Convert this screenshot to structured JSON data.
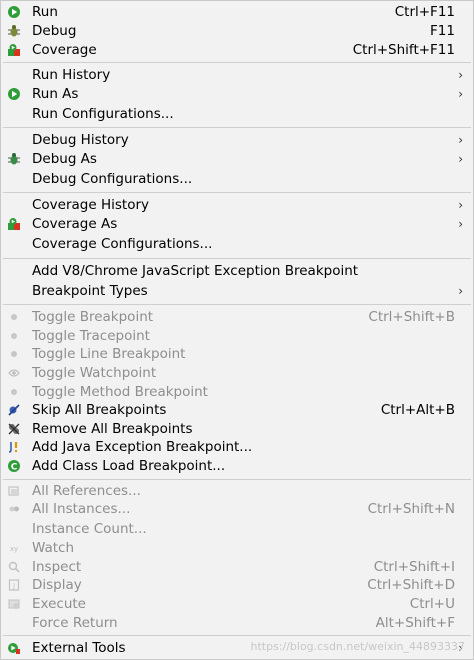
{
  "menu": {
    "items": [
      {
        "label": "Run",
        "shortcut": "Ctrl+F11",
        "icon": "run-icon"
      },
      {
        "label": "Debug",
        "shortcut": "F11",
        "icon": "debug-bug-icon"
      },
      {
        "label": "Coverage",
        "shortcut": "Ctrl+Shift+F11",
        "icon": "coverage-icon"
      },
      {
        "label": "Run History",
        "submenu": true
      },
      {
        "label": "Run As",
        "submenu": true,
        "icon": "run-as-icon"
      },
      {
        "label": "Run Configurations..."
      },
      {
        "label": "Debug History",
        "submenu": true
      },
      {
        "label": "Debug As",
        "submenu": true,
        "icon": "debug-as-icon"
      },
      {
        "label": "Debug Configurations..."
      },
      {
        "label": "Coverage History",
        "submenu": true
      },
      {
        "label": "Coverage As",
        "submenu": true,
        "icon": "coverage-as-icon"
      },
      {
        "label": "Coverage Configurations..."
      },
      {
        "label": "Add V8/Chrome JavaScript Exception Breakpoint"
      },
      {
        "label": "Breakpoint Types",
        "submenu": true
      },
      {
        "label": "Toggle Breakpoint",
        "shortcut": "Ctrl+Shift+B",
        "disabled": true,
        "icon": "breakpoint-dot-icon"
      },
      {
        "label": "Toggle Tracepoint",
        "disabled": true,
        "icon": "tracepoint-dot-icon"
      },
      {
        "label": "Toggle Line Breakpoint",
        "disabled": true,
        "icon": "line-breakpoint-dot-icon"
      },
      {
        "label": "Toggle Watchpoint",
        "disabled": true,
        "icon": "watchpoint-icon"
      },
      {
        "label": "Toggle Method Breakpoint",
        "disabled": true,
        "icon": "method-breakpoint-dot-icon"
      },
      {
        "label": "Skip All Breakpoints",
        "shortcut": "Ctrl+Alt+B",
        "icon": "skip-breakpoints-icon"
      },
      {
        "label": "Remove All Breakpoints",
        "icon": "remove-breakpoints-icon"
      },
      {
        "label": "Add Java Exception Breakpoint...",
        "icon": "java-exception-icon"
      },
      {
        "label": "Add Class Load Breakpoint...",
        "icon": "class-load-icon"
      },
      {
        "label": "All References...",
        "disabled": true,
        "icon": "all-references-icon"
      },
      {
        "label": "All Instances...",
        "shortcut": "Ctrl+Shift+N",
        "disabled": true,
        "icon": "all-instances-icon"
      },
      {
        "label": "Instance Count...",
        "disabled": true
      },
      {
        "label": "Watch",
        "disabled": true,
        "icon": "watch-xy-icon"
      },
      {
        "label": "Inspect",
        "shortcut": "Ctrl+Shift+I",
        "disabled": true,
        "icon": "inspect-icon"
      },
      {
        "label": "Display",
        "shortcut": "Ctrl+Shift+D",
        "disabled": true,
        "icon": "display-icon"
      },
      {
        "label": "Execute",
        "shortcut": "Ctrl+U",
        "disabled": true,
        "icon": "execute-icon"
      },
      {
        "label": "Force Return",
        "shortcut": "Alt+Shift+F",
        "disabled": true
      },
      {
        "label": "External Tools",
        "submenu": true,
        "icon": "external-tools-icon"
      }
    ],
    "submenu_arrow": "›",
    "watermark": "https://blog.csdn.net/weixin_44893337"
  }
}
